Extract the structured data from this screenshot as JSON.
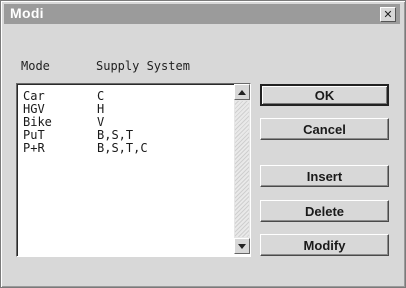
{
  "dialog": {
    "title": "Modi",
    "close_glyph": "✕"
  },
  "list": {
    "headers": {
      "mode": "Mode",
      "supply_system": "Supply System"
    },
    "rows": [
      {
        "mode": "Car",
        "supply": "C"
      },
      {
        "mode": "HGV",
        "supply": "H"
      },
      {
        "mode": "Bike",
        "supply": "V"
      },
      {
        "mode": "PuT",
        "supply": "B,S,T"
      },
      {
        "mode": "P+R",
        "supply": "B,S,T,C"
      }
    ]
  },
  "buttons": {
    "ok": "OK",
    "cancel": "Cancel",
    "insert": "Insert",
    "delete": "Delete",
    "modify": "Modify"
  },
  "icons": {
    "close": "close-icon",
    "scroll_up": "scroll-up-arrow-icon",
    "scroll_down": "scroll-down-arrow-icon"
  }
}
